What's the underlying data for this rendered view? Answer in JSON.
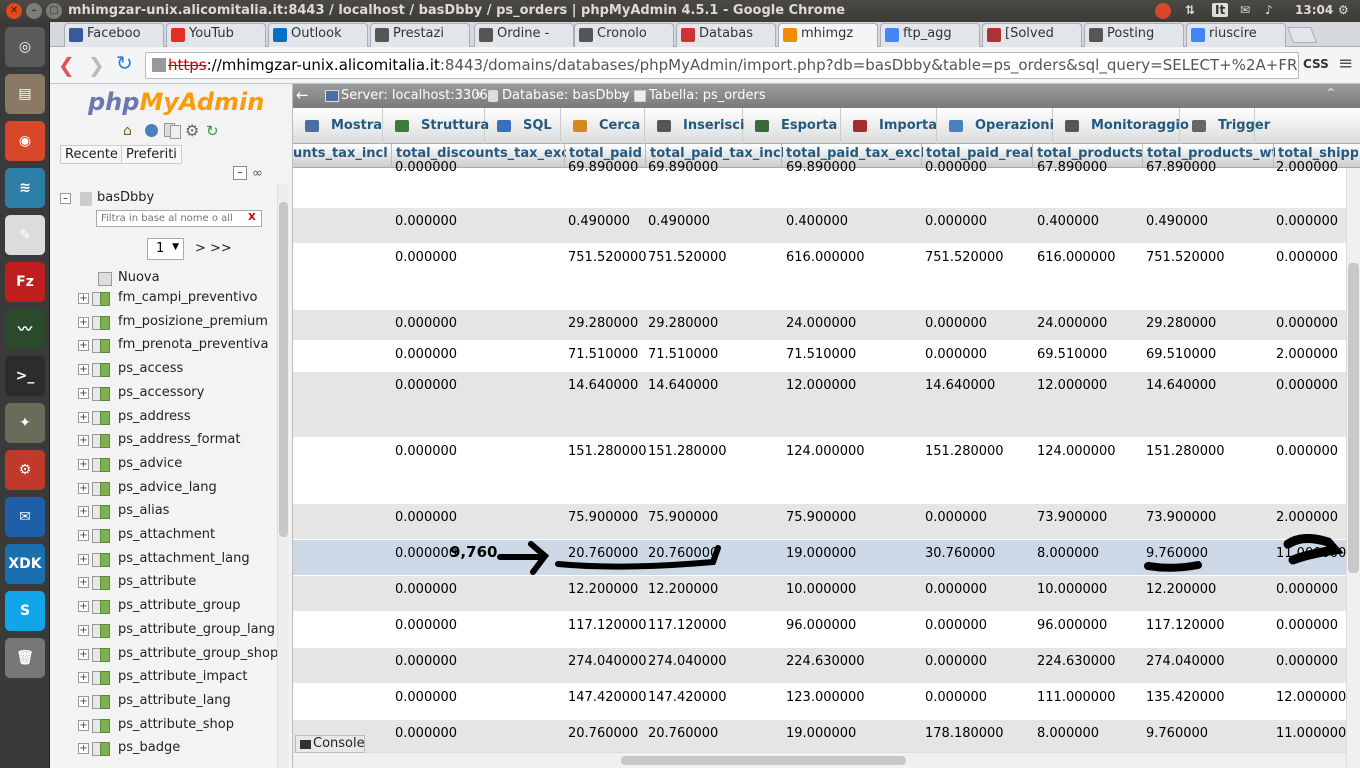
{
  "os": {
    "window_title": "mhimgzar-unix.alicomitalia.it:8443 / localhost / basDbby / ps_orders | phpMyAdmin 4.5.1 - Google Chrome",
    "clock": "13:04",
    "kbd": "It"
  },
  "launcher": [
    {
      "name": "ubuntu-dash",
      "color": "#5a5a5a",
      "glyph": "◎"
    },
    {
      "name": "files",
      "color": "#8a7a65",
      "glyph": "▤"
    },
    {
      "name": "chrome",
      "color": "#d9472b",
      "glyph": "◉"
    },
    {
      "name": "web-browser",
      "color": "#2e7fa8",
      "glyph": "≋"
    },
    {
      "name": "text-editor",
      "color": "#dcdcdc",
      "glyph": "✎"
    },
    {
      "name": "filezilla",
      "color": "#bf1e1e",
      "glyph": "Fz"
    },
    {
      "name": "system-monitor",
      "color": "#2b4a2b",
      "glyph": "〰"
    },
    {
      "name": "terminal",
      "color": "#2c2c2c",
      "glyph": ">_"
    },
    {
      "name": "gimp",
      "color": "#6b6b5a",
      "glyph": "✦"
    },
    {
      "name": "settings",
      "color": "#c0392b",
      "glyph": "⚙"
    },
    {
      "name": "thunderbird",
      "color": "#1f5fa8",
      "glyph": "✉"
    },
    {
      "name": "intel-xdk",
      "color": "#1a6fb0",
      "glyph": "XDK"
    },
    {
      "name": "skype",
      "color": "#12a5e8",
      "glyph": "S"
    },
    {
      "name": "trash",
      "color": "#777",
      "glyph": "🗑"
    }
  ],
  "browser": {
    "tabs": [
      {
        "label": "Faceboo",
        "color": "#3b5998"
      },
      {
        "label": "YouTub",
        "color": "#e52d27"
      },
      {
        "label": "Outlook",
        "color": "#0072c6"
      },
      {
        "label": "Prestazi",
        "color": "#555"
      },
      {
        "label": "Ordine -",
        "color": "#555"
      },
      {
        "label": "Cronolo",
        "color": "#555"
      },
      {
        "label": "Databas",
        "color": "#c33"
      },
      {
        "label": "mhimgz",
        "color": "#f08c00"
      },
      {
        "label": "ftp_agg",
        "color": "#4285f4"
      },
      {
        "label": "[Solved",
        "color": "#a33"
      },
      {
        "label": "Posting",
        "color": "#555"
      },
      {
        "label": "riuscire",
        "color": "#4285f4"
      }
    ],
    "url_scheme": "https",
    "url_host": "://mhimgzar-unix.alicomitalia.it",
    "url_rest": ":8443/domains/databases/phpMyAdmin/import.php?db=basDbby&table=ps_orders&sql_query=SELECT+%2A+FROM+",
    "ext_label": "CSS"
  },
  "pma": {
    "logo_php": "php",
    "logo_my": "MyAdmin",
    "recent": "Recente",
    "favorites": "Preferiti",
    "db_name": "basDbby",
    "filter_placeholder": "Filtra in base al nome o all",
    "filter_clear": "X",
    "page_select": "1",
    "page_next": "> >>",
    "new_label": "Nuova",
    "tables": [
      "fm_campi_preventivo",
      "fm_posizione_premium",
      "fm_prenota_preventiva",
      "ps_access",
      "ps_accessory",
      "ps_address",
      "ps_address_format",
      "ps_advice",
      "ps_advice_lang",
      "ps_alias",
      "ps_attachment",
      "ps_attachment_lang",
      "ps_attribute",
      "ps_attribute_group",
      "ps_attribute_group_lang",
      "ps_attribute_group_shop",
      "ps_attribute_impact",
      "ps_attribute_lang",
      "ps_attribute_shop",
      "ps_badge"
    ]
  },
  "breadcrumb": {
    "server": "Server: localhost:3306",
    "sep1": "»",
    "database": "Database: basDbby",
    "sep2": "»",
    "table": "Tabella: ps_orders"
  },
  "menu_tabs": [
    "Mostra",
    "Struttura",
    "SQL",
    "Cerca",
    "Inserisci",
    "Esporta",
    "Importa",
    "Operazioni",
    "Monitoraggio",
    "Trigger"
  ],
  "columns": [
    "unts_tax_incl",
    "total_discounts_tax_excl",
    "total_paid",
    "total_paid_tax_incl",
    "total_paid_tax_excl",
    "total_paid_real",
    "total_products",
    "total_products_wt",
    "total_shipp"
  ],
  "rows": [
    [
      "",
      "0.000000",
      "69.890000",
      "69.890000",
      "69.890000",
      "0.000000",
      "67.890000",
      "67.890000",
      "2.000000"
    ],
    [
      "",
      "0.000000",
      "0.490000",
      "0.490000",
      "0.400000",
      "0.000000",
      "0.400000",
      "0.490000",
      "0.000000"
    ],
    [
      "",
      "0.000000",
      "751.520000",
      "751.520000",
      "616.000000",
      "751.520000",
      "616.000000",
      "751.520000",
      "0.000000"
    ],
    [
      "",
      "0.000000",
      "29.280000",
      "29.280000",
      "24.000000",
      "0.000000",
      "24.000000",
      "29.280000",
      "0.000000"
    ],
    [
      "",
      "0.000000",
      "71.510000",
      "71.510000",
      "71.510000",
      "0.000000",
      "69.510000",
      "69.510000",
      "2.000000"
    ],
    [
      "",
      "0.000000",
      "14.640000",
      "14.640000",
      "12.000000",
      "14.640000",
      "12.000000",
      "14.640000",
      "0.000000"
    ],
    [
      "",
      "0.000000",
      "151.280000",
      "151.280000",
      "124.000000",
      "151.280000",
      "124.000000",
      "151.280000",
      "0.000000"
    ],
    [
      "",
      "0.000000",
      "75.900000",
      "75.900000",
      "75.900000",
      "0.000000",
      "73.900000",
      "73.900000",
      "2.000000"
    ],
    [
      "",
      "0.000000",
      "20.760000",
      "20.760000",
      "19.000000",
      "30.760000",
      "8.000000",
      "9.760000",
      "11.000000"
    ],
    [
      "",
      "0.000000",
      "12.200000",
      "12.200000",
      "10.000000",
      "0.000000",
      "10.000000",
      "12.200000",
      "0.000000"
    ],
    [
      "",
      "0.000000",
      "117.120000",
      "117.120000",
      "96.000000",
      "0.000000",
      "96.000000",
      "117.120000",
      "0.000000"
    ],
    [
      "",
      "0.000000",
      "274.040000",
      "274.040000",
      "224.630000",
      "0.000000",
      "224.630000",
      "274.040000",
      "0.000000"
    ],
    [
      "",
      "0.000000",
      "147.420000",
      "147.420000",
      "123.000000",
      "0.000000",
      "111.000000",
      "135.420000",
      "12.000000"
    ],
    [
      "",
      "0.000000",
      "20.760000",
      "20.760000",
      "19.000000",
      "178.180000",
      "8.000000",
      "9.760000",
      "11.000000"
    ]
  ],
  "annotation_text": "9,760",
  "console_label": "Console"
}
